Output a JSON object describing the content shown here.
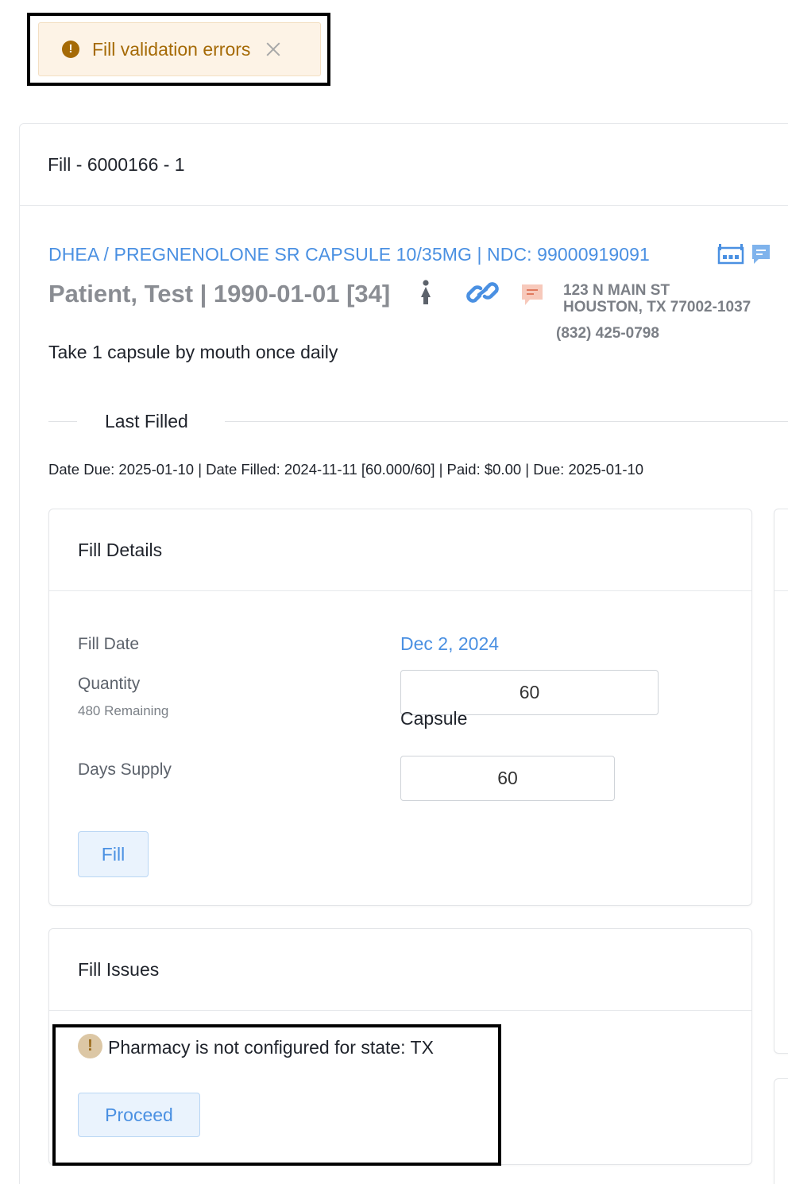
{
  "toast": {
    "message": "Fill validation errors",
    "icon": "warning-icon",
    "accent": "#a56a06",
    "background": "#fdf3e6"
  },
  "panel": {
    "title": "Fill - 6000166 - 1"
  },
  "drug": {
    "line": "DHEA / PREGNENOLONE SR CAPSULE 10/35MG | NDC: 99000919091"
  },
  "patient": {
    "line": "Patient, Test | 1990-01-01 [34]",
    "address_line1": "123 N MAIN ST",
    "address_line2": "HOUSTON, TX 77002-1037",
    "phone": "(832) 425-0798"
  },
  "sig": "Take 1 capsule by mouth once daily",
  "last_filled": {
    "heading": "Last Filled",
    "summary": "Date Due: 2025-01-10 | Date Filled: 2024-11-11 [60.000/60] | Paid: $0.00 | Due: 2025-01-10"
  },
  "fill_details": {
    "title": "Fill Details",
    "fill_date_label": "Fill Date",
    "fill_date_value": "Dec 2, 2024",
    "quantity_label": "Quantity",
    "remaining": "480 Remaining",
    "quantity_value": "60",
    "unit": "Capsule",
    "days_supply_label": "Days Supply",
    "days_supply_value": "60",
    "fill_button": "Fill"
  },
  "fill_issues": {
    "title": "Fill Issues",
    "issue_text": "Pharmacy is not configured for state: TX",
    "proceed_button": "Proceed"
  },
  "colors": {
    "link_blue": "#4a90e2",
    "muted_gray": "#8a8d93"
  }
}
